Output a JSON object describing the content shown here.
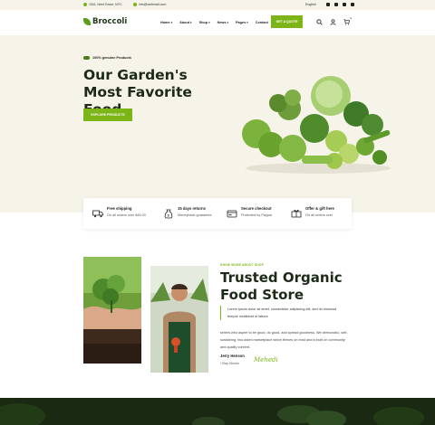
{
  "topbar": {
    "address": "15/A, Nest Tower, NYC",
    "email": "info@webmail.com",
    "language": "English"
  },
  "header": {
    "logo_text": "Broccoli",
    "nav": [
      "Home",
      "About",
      "Shop",
      "News",
      "Pages",
      "Contact"
    ],
    "quote_button": "GET A QUOTE",
    "cart_count": "0",
    "icons": [
      "search-icon",
      "user-icon",
      "cart-icon"
    ]
  },
  "hero": {
    "badge": "100% genuine Products",
    "title": "Our Garden's Most Favorite Food",
    "cta": "EXPLORE PRODUCTS"
  },
  "features": [
    {
      "icon": "truck-icon",
      "title": "Free shipping",
      "subtitle": "On all orders over $49.00"
    },
    {
      "icon": "money-bag-icon",
      "title": "15 days returns",
      "subtitle": "Moneyback guarantee"
    },
    {
      "icon": "credit-card-icon",
      "title": "Secure checkout",
      "subtitle": "Protected by Paypal"
    },
    {
      "icon": "gift-icon",
      "title": "Offer & gift here",
      "subtitle": "On all orders over"
    }
  ],
  "about": {
    "eyebrow": "KNOW MORE ABOUT SHOP",
    "title": "Trusted Organic Food Store",
    "quote": "Lorem ipsum dolor sit amet, consectetur adipiscing elit, sed do eiusmod tempor incididunt ut labore",
    "paragraph": "sellers who aspire to be good, do good, and spread goodness. We democratic, self-sustaining, two-sided marketplace which thrives on trust and is built on community and quality content.",
    "author": "Jerry Henson",
    "role": "/ Shop Director",
    "signature": "Mehedi"
  },
  "colors": {
    "accent": "#7cb518",
    "hero_bg": "#f6f4e9",
    "dark": "#1c2a17"
  }
}
